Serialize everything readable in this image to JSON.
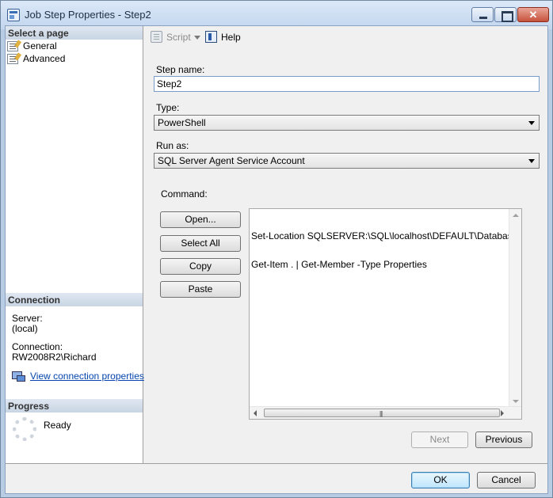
{
  "window": {
    "title": "Job Step Properties - Step2"
  },
  "left_pane": {
    "select_page_header": "Select a page",
    "pages": [
      {
        "label": "General"
      },
      {
        "label": "Advanced"
      }
    ],
    "connection_header": "Connection",
    "server_label": "Server:",
    "server_value": "(local)",
    "connection_label": "Connection:",
    "connection_value": "RW2008R2\\Richard",
    "view_connection_link": "View connection properties",
    "progress_header": "Progress",
    "progress_status": "Ready"
  },
  "toolbar": {
    "script_label": "Script",
    "help_label": "Help"
  },
  "form": {
    "step_name_label": "Step name:",
    "step_name_value": "Step2",
    "type_label": "Type:",
    "type_value": "PowerShell",
    "run_as_label": "Run as:",
    "run_as_value": "SQL Server Agent Service Account",
    "command_label": "Command:",
    "command_buttons": {
      "open": "Open...",
      "select_all": "Select All",
      "copy": "Copy",
      "paste": "Paste"
    },
    "command_lines": [
      "Set-Location SQLSERVER:\\SQL\\localhost\\DEFAULT\\Databases\\msd",
      "Get-Item . | Get-Member -Type Properties"
    ],
    "next_label": "Next",
    "previous_label": "Previous"
  },
  "footer": {
    "ok_label": "OK",
    "cancel_label": "Cancel"
  },
  "icons": {
    "title": "job-step-icon",
    "page": "property-page-icon",
    "connection": "connection-properties-icon",
    "progress": "progress-spinner-icon",
    "script": "script-icon",
    "help": "help-icon"
  }
}
